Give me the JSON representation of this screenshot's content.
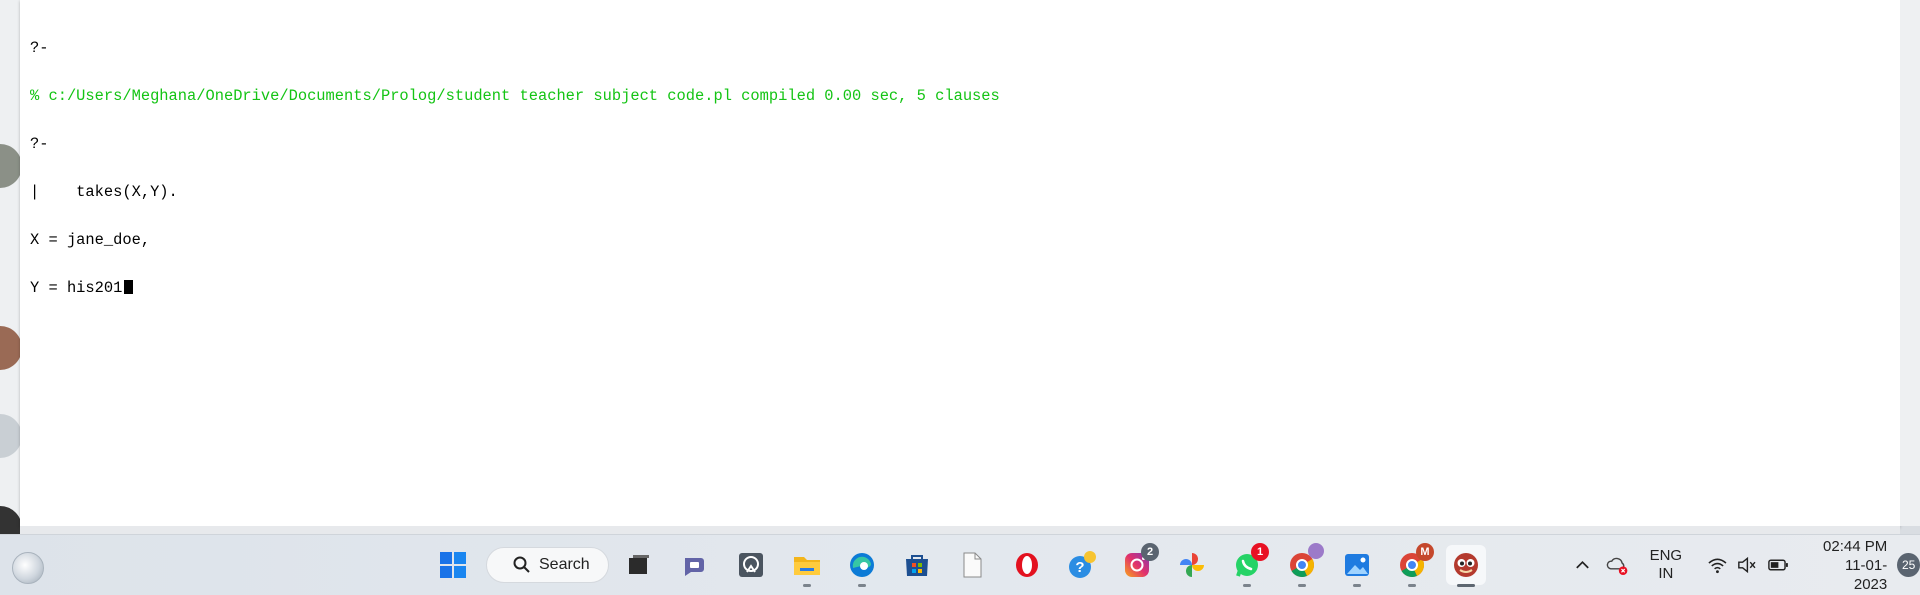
{
  "console": {
    "lines": [
      "?-",
      "% c:/Users/Meghana/OneDrive/Documents/Prolog/student teacher subject code.pl compiled 0.00 sec, 5 clauses",
      "?-",
      "|    takes(X,Y).",
      "X = jane_doe,",
      "Y = his201"
    ]
  },
  "taskbar": {
    "search_label": "Search",
    "icons": [
      {
        "name": "start-windows-icon"
      },
      {
        "name": "task-view-icon"
      },
      {
        "name": "teams-chat-icon"
      },
      {
        "name": "remote-app-icon"
      },
      {
        "name": "file-explorer-icon"
      },
      {
        "name": "edge-browser-icon"
      },
      {
        "name": "microsoft-store-icon"
      },
      {
        "name": "notepad-file-icon"
      },
      {
        "name": "opera-browser-icon"
      },
      {
        "name": "help-icon"
      },
      {
        "name": "instagram-icon",
        "badge": "2"
      },
      {
        "name": "photos-icon"
      },
      {
        "name": "whatsapp-icon",
        "badge": "1"
      },
      {
        "name": "chrome-profile-icon"
      },
      {
        "name": "photos-app-icon"
      },
      {
        "name": "chrome-m-profile-icon",
        "badge": "M"
      },
      {
        "name": "swi-prolog-icon"
      }
    ],
    "tray": {
      "language_top": "ENG",
      "language_bottom": "IN",
      "time": "02:44 PM",
      "date": "11-01-2023",
      "notification_count": "25"
    }
  },
  "colors": {
    "console_green": "#14c414",
    "badge_red": "#e81123",
    "badge_gray": "#5a6470"
  }
}
